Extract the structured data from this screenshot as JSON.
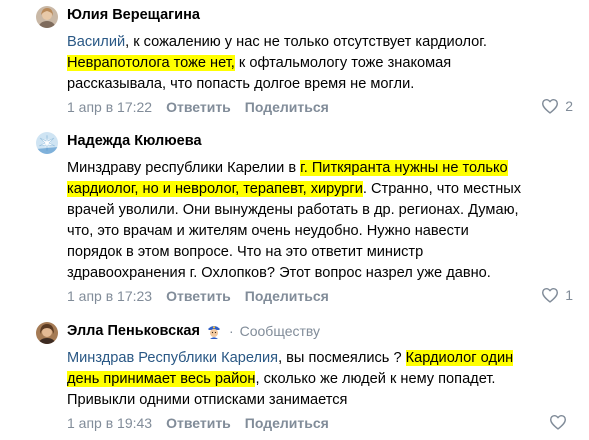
{
  "comments": [
    {
      "author": "Юлия Верещагина",
      "mention": "Василий",
      "line1_rest": ", к сожалению у нас не только отсутствует кардиолог.",
      "line2_highlight": "Неврапотолога тоже нет,",
      "line2_rest": " к офтальмологу тоже знакомая",
      "line3": "рассказывала, что попасть долгое время не могли.",
      "date": "1 апр в 17:22",
      "reply": "Ответить",
      "share": "Поделиться",
      "likes": "2"
    },
    {
      "author": "Надежда Кюлюева",
      "line1_plain": "Минздраву республики Карелии в ",
      "line1_highlight": "г. Питкяранта нужны не только",
      "line2_highlight": "кардиолог, но и невролог, терапевт, хирурги",
      "line2_rest": ". Странно, что местных",
      "line3": "врачей уволили. Они вынуждены работать в др. регионах. Думаю,",
      "line4": "что, это врачам и жителям очень неудобно. Нужно навести",
      "line5": "порядок в этом вопросе. Что на это ответит министр",
      "line6": "здравоохранения г. Охлопков? Этот вопрос назрел уже давно.",
      "date": "1 апр в 17:23",
      "reply": "Ответить",
      "share": "Поделиться",
      "likes": "1"
    },
    {
      "author": "Элла Пеньковская",
      "dot": "·",
      "community": "Сообществу",
      "mention": "Минздрав Республики Карелия",
      "line1_rest": ", вы посмеялись ? ",
      "line1_highlight": "Кардиолог один",
      "line2_highlight": "день принимает весь район",
      "line2_rest": ", сколько же людей к нему попадет.",
      "line3": "Привыкли одними отписками занимается",
      "date": "1 апр в 19:43",
      "reply": "Ответить",
      "share": "Поделиться"
    }
  ],
  "colors": {
    "link": "#2a5885",
    "meta": "#818c99",
    "highlight": "#ffff00"
  },
  "icons": {
    "like": "heart-icon",
    "moderator": "police-officer-icon"
  }
}
